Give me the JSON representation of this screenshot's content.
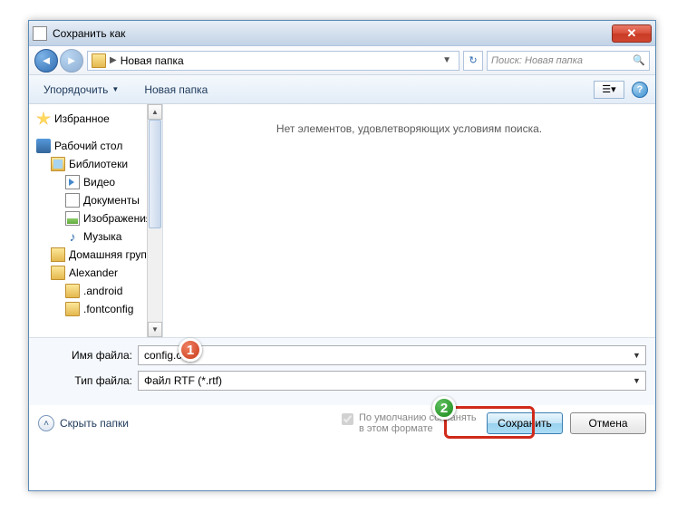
{
  "window": {
    "title": "Сохранить как"
  },
  "breadcrumb": {
    "current": "Новая папка"
  },
  "search": {
    "placeholder": "Поиск: Новая папка"
  },
  "toolbar": {
    "organize": "Упорядочить",
    "newfolder": "Новая папка"
  },
  "empty_message": "Нет элементов, удовлетворяющих условиям поиска.",
  "tree": {
    "favorites": "Избранное",
    "desktop": "Рабочий стол",
    "libraries": "Библиотеки",
    "video": "Видео",
    "documents": "Документы",
    "images": "Изображения",
    "music": "Музыка",
    "homegroup": "Домашняя груп",
    "user": "Alexander",
    "f1": ".android",
    "f2": ".fontconfig"
  },
  "fields": {
    "filename_label": "Имя файла:",
    "filename_value": "config.cfg",
    "filetype_label": "Тип файла:",
    "filetype_value": "Файл RTF (*.rtf)"
  },
  "default_save": "По умолчанию сохранять в этом формате",
  "hide_folders": "Скрыть папки",
  "buttons": {
    "save": "Сохранить",
    "cancel": "Отмена"
  },
  "callouts": {
    "one": "1",
    "two": "2"
  }
}
